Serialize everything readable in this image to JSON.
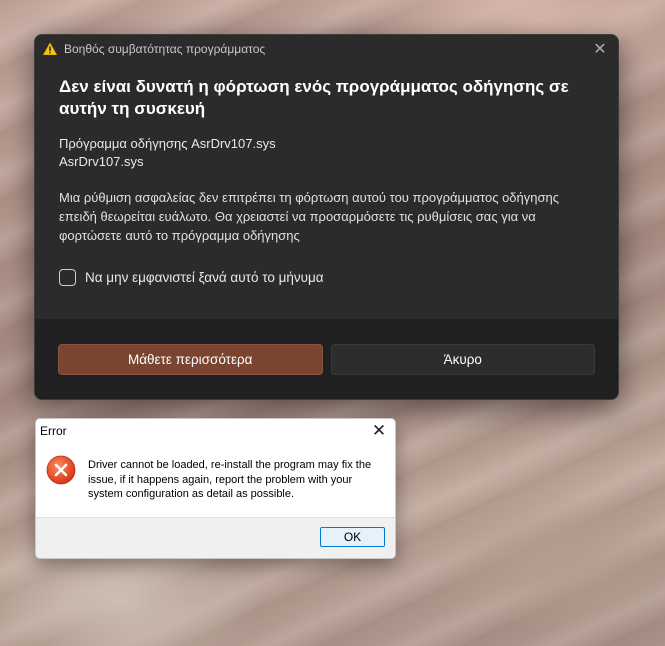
{
  "compat_dialog": {
    "title": "Βοηθός συμβατότητας προγράμματος",
    "heading": "Δεν είναι δυνατή η φόρτωση ενός προγράμματος οδήγησης σε αυτήν τη συσκευή",
    "driver_line1": "Πρόγραμμα οδήγησης AsrDrv107.sys",
    "driver_line2": "AsrDrv107.sys",
    "description": "Μια ρύθμιση ασφαλείας δεν επιτρέπει τη φόρτωση αυτού του προγράμματος οδήγησης επειδή θεωρείται ευάλωτο. Θα χρειαστεί να προσαρμόσετε τις ρυθμίσεις σας για να φορτώσετε αυτό το πρόγραμμα οδήγησης",
    "checkbox_label": "Να μην εμφανιστεί ξανά αυτό το μήνυμα",
    "checkbox_checked": false,
    "learn_more_label": "Μάθετε περισσότερα",
    "cancel_label": "Άκυρο",
    "accent_color": "#7a4530",
    "icon": "warning-icon"
  },
  "error_dialog": {
    "title": "Error",
    "message": "Driver cannot be loaded, re-install the program may fix the issue, if it happens again, report the problem with your system configuration as detail as possible.",
    "ok_label": "OK",
    "icon": "error-icon",
    "icon_color": "#e8451f"
  }
}
